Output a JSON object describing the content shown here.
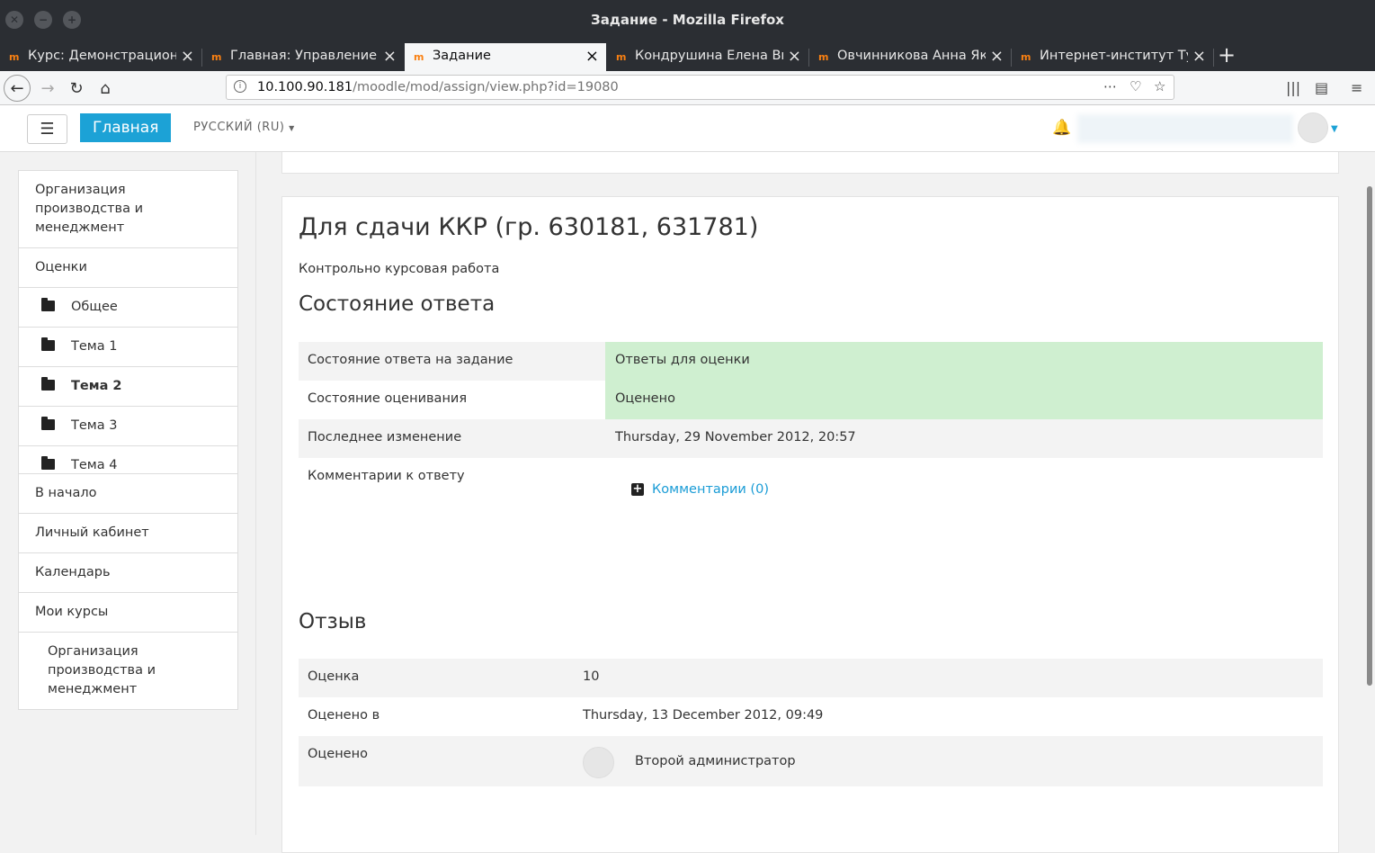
{
  "window": {
    "title": "Задание - Mozilla Firefox"
  },
  "tabs": [
    {
      "label": "Курс: Демонстрационн"
    },
    {
      "label": "Главная: Управление"
    },
    {
      "label": "Задание"
    },
    {
      "label": "Кондрушина Елена Ви"
    },
    {
      "label": "Овчинникова Анна Як"
    },
    {
      "label": "Интернет-институт Ту"
    }
  ],
  "address": {
    "host": "10.100.90.181",
    "path": "/moodle/mod/assign/view.php?id=19080"
  },
  "header": {
    "home_label": "Главная",
    "language": "РУССКИЙ (RU)"
  },
  "sidebar": {
    "course": [
      {
        "label": "Организация производства и менеджмент"
      },
      {
        "label": "Оценки"
      },
      {
        "label": "Общее"
      },
      {
        "label": "Тема 1"
      },
      {
        "label": "Тема 2"
      },
      {
        "label": "Тема 3"
      },
      {
        "label": "Тема 4"
      }
    ],
    "site": [
      {
        "label": "В начало"
      },
      {
        "label": "Личный кабинет"
      },
      {
        "label": "Календарь"
      },
      {
        "label": "Мои курсы"
      },
      {
        "label": "Организация производства и менеджмент"
      }
    ]
  },
  "main": {
    "title": "Для сдачи ККР (гр. 630181, 631781)",
    "intro": "Контрольно курсовая работа",
    "status_heading": "Состояние ответа",
    "status_rows": [
      {
        "label": "Состояние ответа на задание",
        "value": "Ответы для оценки"
      },
      {
        "label": "Состояние оценивания",
        "value": "Оценено"
      },
      {
        "label": "Последнее изменение",
        "value": "Thursday, 29 November 2012, 20:57"
      },
      {
        "label": "Комментарии к ответу",
        "value": "Комментарии (0)"
      }
    ],
    "feedback_heading": "Отзыв",
    "feedback_rows": [
      {
        "label": "Оценка",
        "value": "10"
      },
      {
        "label": "Оценено в",
        "value": "Thursday, 13 December 2012, 09:49"
      },
      {
        "label": "Оценено",
        "value": "Второй администратор"
      }
    ]
  },
  "colors": {
    "accent": "#1ca2d6",
    "status_green": "#cfefd0",
    "firefox_dark": "#2b2e33"
  }
}
